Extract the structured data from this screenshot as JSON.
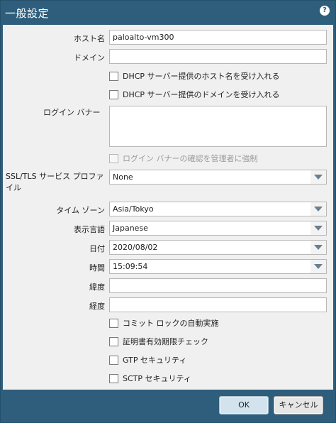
{
  "dialog": {
    "title": "一般設定",
    "help_icon": "question-mark-icon"
  },
  "fields": {
    "hostname_label": "ホスト名",
    "hostname_value": "paloalto-vm300",
    "domain_label": "ドメイン",
    "domain_value": "",
    "dhcp_hostname_label": "DHCP サーバー提供のホスト名を受け入れる",
    "dhcp_domain_label": "DHCP サーバー提供のドメインを受け入れる",
    "login_banner_label": "ログイン バナー",
    "login_banner_value": "",
    "force_ack_label": "ログイン バナーの確認を管理者に強制",
    "ssl_profile_label": "SSL/TLS サービス プロファイル",
    "ssl_profile_value": "None",
    "timezone_label": "タイム ゾーン",
    "timezone_value": "Asia/Tokyo",
    "locale_label": "表示言語",
    "locale_value": "Japanese",
    "date_label": "日付",
    "date_value": "2020/08/02",
    "time_label": "時間",
    "time_value": "15:09:54",
    "latitude_label": "緯度",
    "latitude_value": "",
    "longitude_label": "経度",
    "longitude_value": ""
  },
  "checkboxes": {
    "commit_lock_label": "コミット ロックの自動実施",
    "cert_expiry_label": "証明書有効期限チェック",
    "gtp_label": "GTP セキュリティ",
    "sctp_label": "SCTP セキュリティ"
  },
  "buttons": {
    "ok": "OK",
    "cancel": "キャンセル"
  }
}
